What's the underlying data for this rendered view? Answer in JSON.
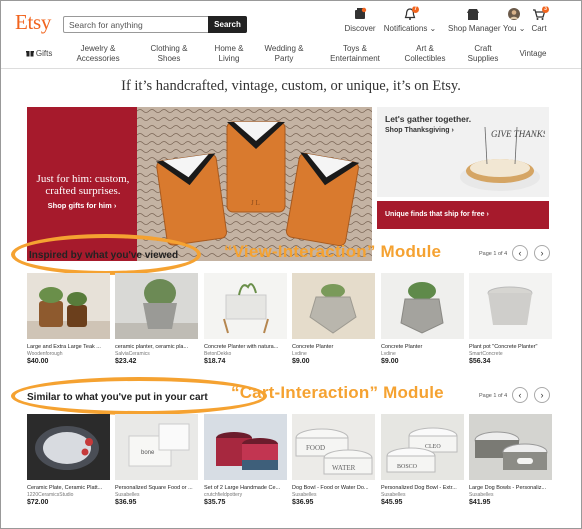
{
  "header": {
    "logo": "Etsy",
    "search_placeholder": "Search for anything",
    "search_button": "Search",
    "nav": [
      {
        "label": "Discover",
        "icon": "discover-icon"
      },
      {
        "label": "Notifications ⌄",
        "icon": "bell-icon",
        "badge": "7"
      },
      {
        "label": "Shop Manager",
        "icon": "shop-icon"
      },
      {
        "label": "You ⌄",
        "icon": "avatar-icon"
      },
      {
        "label": "Cart",
        "icon": "cart-icon",
        "badge": "3"
      }
    ]
  },
  "categories": [
    {
      "label": "Gifts",
      "icon": "gift-icon"
    },
    {
      "label": "Jewelry & Accessories"
    },
    {
      "label": "Clothing & Shoes"
    },
    {
      "label": "Home & Living"
    },
    {
      "label": "Wedding & Party"
    },
    {
      "label": "Toys & Entertainment"
    },
    {
      "label": "Art & Collectibles"
    },
    {
      "label": "Craft Supplies"
    },
    {
      "label": "Vintage"
    }
  ],
  "tagline": "If it’s handcrafted, vintage, custom, or unique, it’s on Etsy.",
  "hero": {
    "headline": "Just for him: custom, crafted surprises.",
    "cta": "Shop gifts for him ›"
  },
  "promo": {
    "title": "Let's gather together.",
    "cta": "Shop Thanksgiving ›",
    "sign": "GIVE THANKS"
  },
  "banner": {
    "text": "Unique finds that ship for free ›"
  },
  "colors": {
    "brand": "#f1641e",
    "hero_red": "#a61a2c",
    "annotation": "#f5a231"
  },
  "sections": [
    {
      "title": "Inspired by what you've viewed",
      "module_label": "“View-Interaction” Module",
      "pager": "Page 1 of 4",
      "items": [
        {
          "title": "Large and Extra Large Teak ...",
          "shop": "Woodenforough",
          "price": "$40.00"
        },
        {
          "title": "ceramic planter, ceramic pla...",
          "shop": "SalviaCeramics",
          "price": "$23.42"
        },
        {
          "title": "Concrete Planter with natura...",
          "shop": "BetonDekko",
          "price": "$18.74"
        },
        {
          "title": "Concrete Planter",
          "shop": "Lvdine",
          "price": "$9.00"
        },
        {
          "title": "Concrete Planter",
          "shop": "Lvdine",
          "price": "$9.00"
        },
        {
          "title": "Plant pot \"Concrete Planter\"",
          "shop": "SmartConcrete",
          "price": "$56.34"
        }
      ]
    },
    {
      "title": "Similar to what you've put in your cart",
      "module_label": "“Cart-Interaction” Module",
      "pager": "Page 1 of 4",
      "items": [
        {
          "title": "Ceramic Plate, Ceramic Platt...",
          "shop": "1220CeramicsStudio",
          "price": "$72.00"
        },
        {
          "title": "Personalized Square Food or ...",
          "shop": "Susabelles",
          "price": "$36.95"
        },
        {
          "title": "Set of 2 Large Handmade Ce...",
          "shop": "crutchfieldpottery",
          "price": "$35.75"
        },
        {
          "title": "Dog Bowl - Food or Water Do...",
          "shop": "Susabelles",
          "price": "$36.95"
        },
        {
          "title": "Personalized Dog Bowl - Extr...",
          "shop": "Susabelles",
          "price": "$45.95"
        },
        {
          "title": "Large Dog Bowls - Personaliz...",
          "shop": "Susabelles",
          "price": "$41.95"
        }
      ]
    }
  ]
}
